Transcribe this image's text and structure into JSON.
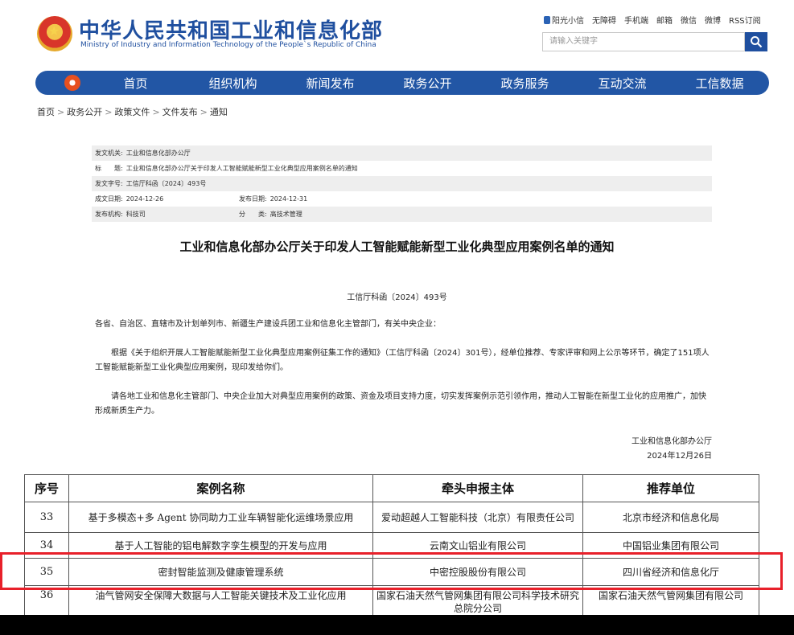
{
  "header": {
    "title": "中华人民共和国工业和信息化部",
    "subtitle": "Ministry of Industry and Information Technology of the People`s Republic of China",
    "top_links": [
      "阳光小信",
      "无障碍",
      "手机端",
      "邮箱",
      "微信",
      "微博",
      "RSS订阅"
    ],
    "search_placeholder": "请输入关键字"
  },
  "nav": {
    "items": [
      "首页",
      "组织机构",
      "新闻发布",
      "政务公开",
      "政务服务",
      "互动交流",
      "工信数据"
    ]
  },
  "breadcrumb": [
    "首页",
    "政务公开",
    "政策文件",
    "文件发布",
    "通知"
  ],
  "meta": {
    "issuer_label": "发文机关:",
    "issuer": "工业和信息化部办公厅",
    "title_label": "标　　题:",
    "title": "工业和信息化部办公厅关于印发人工智能赋能新型工业化典型应用案例名单的通知",
    "doc_no_label": "发文字号:",
    "doc_no": "工信厅科函〔2024〕493号",
    "created_label": "成文日期:",
    "created": "2024-12-26",
    "published_label": "发布日期:",
    "published": "2024-12-31",
    "org_label": "发布机构:",
    "org": "科技司",
    "category_label": "分　　类:",
    "category": "高技术管理"
  },
  "doc": {
    "title": "工业和信息化部办公厅关于印发人工智能赋能新型工业化典型应用案例名单的通知",
    "number": "工信厅科函〔2024〕493号",
    "addressee": "各省、自治区、直辖市及计划单列市、新疆生产建设兵团工业和信息化主管部门，有关中央企业：",
    "para1": "根据《关于组织开展人工智能赋能新型工业化典型应用案例征集工作的通知》（工信厅科函〔2024〕301号），经单位推荐、专家评审和网上公示等环节，确定了151项人工智能赋能新型工业化典型应用案例，现印发给你们。",
    "para2": "请各地工业和信息化主管部门、中央企业加大对典型应用案例的政策、资金及项目支持力度，切实发挥案例示范引领作用，推动人工智能在新型工业化的应用推广，加快形成新质生产力。",
    "sign_org": "工业和信息化部办公厅",
    "sign_date": "2024年12月26日"
  },
  "table": {
    "headers": [
      "序号",
      "案例名称",
      "牵头申报主体",
      "推荐单位"
    ],
    "rows": [
      [
        "33",
        "基于多模态+多 Agent 协同助力工业车辆智能化运维场景应用",
        "爱动超越人工智能科技（北京）有限责任公司",
        "北京市经济和信息化局"
      ],
      [
        "34",
        "基于人工智能的铝电解数字孪生模型的开发与应用",
        "云南文山铝业有限公司",
        "中国铝业集团有限公司"
      ],
      [
        "35",
        "密封智能监测及健康管理系统",
        "中密控股股份有限公司",
        "四川省经济和信息化厅"
      ],
      [
        "36",
        "油气管网安全保障大数据与人工智能关键技术及工业化应用",
        "国家石油天然气管网集团有限公司科学技术研究总院分公司",
        "国家石油天然气管网集团有限公司"
      ]
    ]
  }
}
